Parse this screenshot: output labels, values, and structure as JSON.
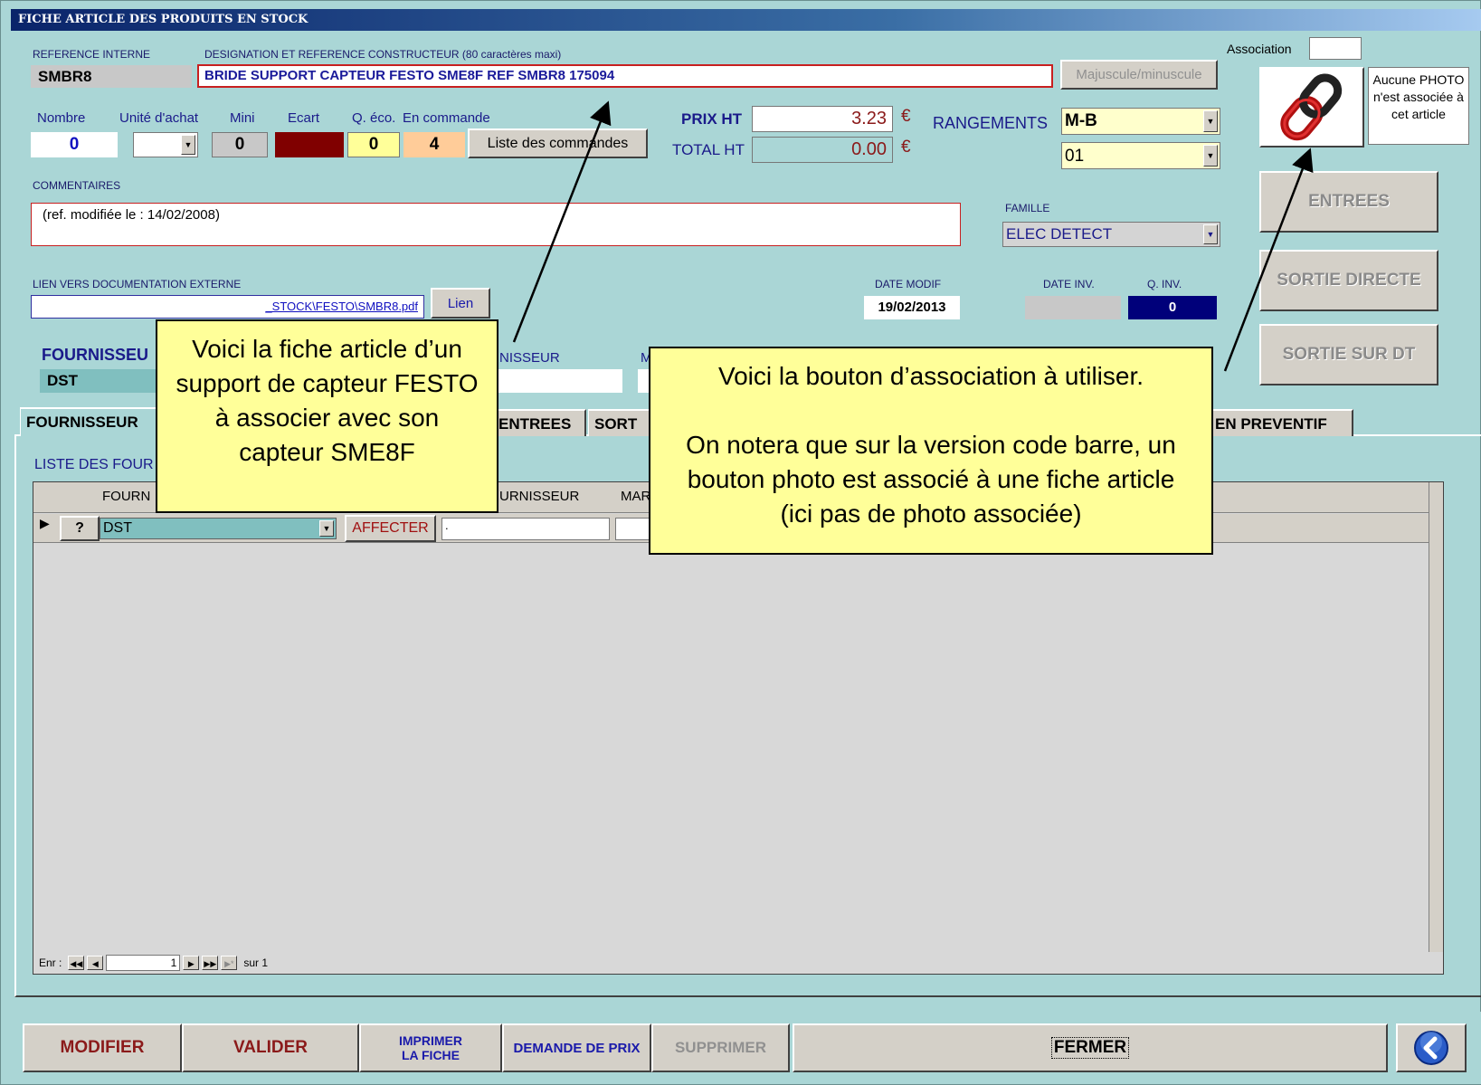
{
  "window": {
    "title": "FICHE ARTICLE DES PRODUITS EN STOCK"
  },
  "header": {
    "ref_interne_label": "REFERENCE INTERNE",
    "ref_interne_value": "SMBR8",
    "designation_label": "DESIGNATION ET REFERENCE CONSTRUCTEUR (80 caractères maxi)",
    "designation_value": "BRIDE SUPPORT CAPTEUR FESTO SME8F  REF SMBR8 175094",
    "majuscule_button": "Majuscule/minuscule",
    "association_label": "Association",
    "association_value": ""
  },
  "quantities": {
    "nombre_label": "Nombre",
    "unite_label": "Unité d'achat",
    "mini_label": "Mini",
    "ecart_label": "Ecart",
    "qeco_label": "Q. éco.",
    "commande_label": "En commande",
    "nombre_value": "0",
    "unite_value": "",
    "mini_value": "0",
    "ecart_value": "",
    "qeco_value": "0",
    "commande_value": "4",
    "liste_button": "Liste des commandes"
  },
  "prices": {
    "prix_ht_label": "PRIX HT",
    "prix_ht_value": "3.23",
    "total_ht_label": "TOTAL HT",
    "total_ht_value": "0.00",
    "currency": "€"
  },
  "rangements": {
    "label": "RANGEMENTS",
    "value1": "M-B",
    "value2": "01"
  },
  "photo": {
    "text": "Aucune PHOTO n'est associée à cet article"
  },
  "commentaires": {
    "label": "COMMENTAIRES",
    "value": "(ref. modifiée le : 14/02/2008)"
  },
  "famille": {
    "label": "FAMILLE",
    "value": "ELEC DETECT"
  },
  "side_buttons": {
    "entrees": "ENTREES",
    "sortie_directe": "SORTIE DIRECTE",
    "sortie_dt": "SORTIE SUR DT"
  },
  "lien": {
    "label": "LIEN VERS DOCUMENTATION EXTERNE",
    "value": "_STOCK\\FESTO\\SMBR8.pdf",
    "button": "Lien"
  },
  "dates": {
    "date_modif_label": "DATE MODIF",
    "date_modif_value": "19/02/2013",
    "date_inv_label": "DATE INV.",
    "date_inv_value": "",
    "q_inv_label": "Q. INV.",
    "q_inv_value": "0"
  },
  "fournisseur": {
    "label": "FOURNISSEU",
    "value": "DST",
    "ref_label": "NISSEUR",
    "m_label": "M"
  },
  "tabs": [
    {
      "label": "FOURNISSEUR"
    },
    {
      "label": "ENTREES"
    },
    {
      "label": "SORT"
    },
    {
      "label": "EN PREVENTIF"
    }
  ],
  "subform": {
    "title": "LISTE DES FOUR",
    "col_fourn": "FOURN",
    "col_fournisseur": "URNISSEUR",
    "col_mar": "MAR",
    "row_supplier": "DST",
    "row_button": "AFFECTER",
    "row_ref": ".",
    "nav_label": "Enr :",
    "nav_record": "1",
    "nav_total": "sur  1"
  },
  "notes": {
    "left": "Voici la fiche article d’un support de capteur FESTO à associer avec son capteur SME8F",
    "right_line1": "Voici la bouton d’association à utiliser.",
    "right_line2": "On notera que sur la version code barre, un bouton photo est associé à une fiche article (ici pas de photo associée)"
  },
  "bottom": {
    "modifier": "MODIFIER",
    "valider": "VALIDER",
    "imprimer": "IMPRIMER LA FICHE",
    "demande": "DEMANDE DE PRIX",
    "supprimer": "SUPPRIMER",
    "fermer": "FERMER"
  },
  "icons": {
    "association": "chain-link-icon",
    "back": "arrow-left-circle-icon"
  },
  "colors": {
    "background": "#aad6d6",
    "title_bar": "#0a246a",
    "note": "#ffff99",
    "ecart": "#800000",
    "q_inv": "#00007a"
  }
}
